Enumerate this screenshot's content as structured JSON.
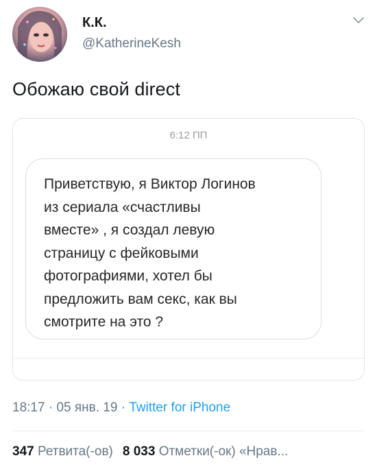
{
  "author": {
    "display_name": "К.К.",
    "handle": "@KatherineKesh"
  },
  "tweet": {
    "text": "Обожаю свой direct"
  },
  "media": {
    "time": "6:12 ПП",
    "message": "Приветствую, я Виктор Логинов\nиз сериала «счастливы\nвместе» , я создал левую\nстраницу с фейковыми\nфотографиями, хотел бы\nпредложить вам секс, как вы\nсмотрите на это ?"
  },
  "meta": {
    "time": "18:17",
    "sep1": " · ",
    "date": "05 янв. 19",
    "sep2": " · ",
    "source": "Twitter for iPhone"
  },
  "stats": {
    "retweets_count": "347",
    "retweets_label": "Ретвита(-ов)",
    "likes_count": "8 033",
    "likes_label": "Отметки(-ок) «Нрав..."
  },
  "colors": {
    "text": "#14171a",
    "secondary": "#657786",
    "link": "#1da1f2"
  },
  "icons": {
    "menu": "chevron-down-icon",
    "avatar": "avatar"
  }
}
